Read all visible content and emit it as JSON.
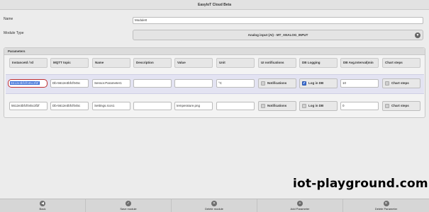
{
  "app": {
    "title": "EasyIoT Cloud Beta"
  },
  "form": {
    "name_label": "Name",
    "name_value": "Module0",
    "type_label": "Module Type",
    "type_value": "Analog input (AI) - MT_ANALOG_INPUT"
  },
  "parameters": {
    "title": "Parameters",
    "headers": [
      "InstanceId / Id",
      "MQTT topic",
      "Name",
      "Description",
      "Value",
      "Unit",
      "UI notifications",
      "DB Logging",
      "DB Avg.Interval(min",
      "Chart steps"
    ],
    "rows": [
      {
        "instance_id": "5612e3bfcf045c3f2f",
        "mqtt_topic": "Db-5612e3bfcf045c",
        "name": "Sensor.Parameter1",
        "description": "",
        "value": "",
        "unit": "°C",
        "notifications_label": "Notifications",
        "notifications_checked": false,
        "log_label": "Log in DB",
        "log_checked": true,
        "avg_interval": "10",
        "chart_steps_label": "Chart steps",
        "chart_steps_checked": false
      },
      {
        "instance_id": "5612e3bfcf045c3f2f",
        "mqtt_topic": "Db-5612e3bfcf045c",
        "name": "Settings.Icon1",
        "description": "",
        "value": "temperature.png",
        "unit": "",
        "notifications_label": "Notifications",
        "notifications_checked": false,
        "log_label": "Log in DB",
        "log_checked": false,
        "avg_interval": "0",
        "chart_steps_label": "Chart steps",
        "chart_steps_checked": false
      }
    ]
  },
  "watermark": "iot-playground.com",
  "footer": {
    "back": "Back",
    "save": "Save module",
    "delete_module": "Delete module",
    "add_param": "Add Parameter",
    "delete_param": "Delete Parameter"
  },
  "icons": {
    "dropdown": "chevron-down-icon",
    "checkbox": "checkbox-icon",
    "back": "arrow-left-icon",
    "save": "check-icon",
    "delete": "delete-icon",
    "add": "plus-icon"
  },
  "colors": {
    "selection": "#3a6fd8",
    "selected_row": "#e3e3f2",
    "focus_outline": "#c03030"
  }
}
